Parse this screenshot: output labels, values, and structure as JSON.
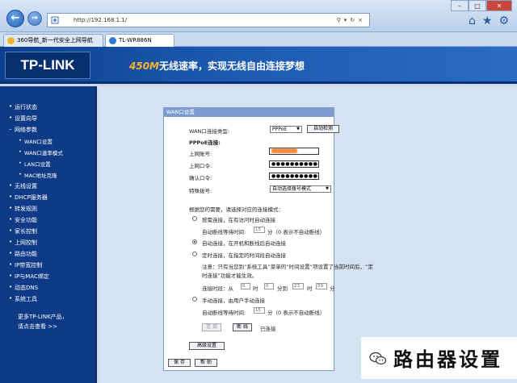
{
  "browser": {
    "url": "http://192.168.1.1/",
    "tabs": [
      {
        "label": "360导航_新一代安全上网导航"
      },
      {
        "label": "TL-WR886N"
      }
    ]
  },
  "banner": {
    "logo": "TP-LINK",
    "slogan_highlight": "450M",
    "slogan_rest": "无线速率，实现无线自由连接梦想"
  },
  "sidebar": {
    "items": [
      {
        "label": "运行状态"
      },
      {
        "label": "设置向导"
      },
      {
        "label": "网络参数"
      },
      {
        "label": "WAN口设置"
      },
      {
        "label": "WAN口速率模式"
      },
      {
        "label": "LAN口设置"
      },
      {
        "label": "MAC地址克隆"
      },
      {
        "label": "无线设置"
      },
      {
        "label": "DHCP服务器"
      },
      {
        "label": "转发规则"
      },
      {
        "label": "安全功能"
      },
      {
        "label": "家长控制"
      },
      {
        "label": "上网控制"
      },
      {
        "label": "路由功能"
      },
      {
        "label": "IP带宽控制"
      },
      {
        "label": "IP与MAC绑定"
      },
      {
        "label": "动态DNS"
      },
      {
        "label": "系统工具"
      }
    ],
    "more_line1": "更多TP-LINK产品，",
    "more_line2": "请点击查看 >>"
  },
  "panel": {
    "title": "WAN口设置",
    "conn_type_label": "WAN口连接类型:",
    "conn_type_value": "PPPoE",
    "auto_detect": "自动检测",
    "pppoe_section": "PPPoE连接:",
    "account_label": "上网账号:",
    "password_label": "上网口令:",
    "password_value": "●●●●●●●●●●●●●●",
    "confirm_label": "确认口令:",
    "confirm_value": "●●●●●●●●●●●●●●",
    "special_dial_label": "特殊拨号:",
    "special_dial_value": "自动选择拨号模式",
    "mode_intro": "根据您的需要，请选择对应的连接模式：",
    "mode1": "按需连接，在有访问时自动连接",
    "mode1_idle_label": "自动断线等待时间:",
    "mode1_idle_value": "15",
    "mode1_idle_suffix": "分（0 表示不自动断线）",
    "mode2": "自动连接，在开机和断线后自动连接",
    "mode3": "定时连接，在指定的时间段自动连接",
    "note_line1": "注意：只有当您到“系统工具”菜单的“时间设置”项设置了当前时间后，“定",
    "note_line2": "时连接”功能才能生效。",
    "period_label": "连接时段：从",
    "from_h": "0",
    "hour_1": "时",
    "from_m": "0",
    "min_to": "分到",
    "to_h": "23",
    "hour_2": "时",
    "to_m": "59",
    "minute": "分",
    "mode4": "手动连接，由用户手动连接",
    "mode4_idle_label": "自动断线等待时间:",
    "mode4_idle_value": "15",
    "mode4_idle_suffix": "分（0 表示不自动断线）",
    "connect_btn": "连 接",
    "disconnect_btn": "断 线",
    "status": "已连接",
    "advanced_btn": "高级设置",
    "save_btn": "保 存",
    "help_btn": "帮 助"
  },
  "watermark": {
    "text": "路由器设置"
  }
}
